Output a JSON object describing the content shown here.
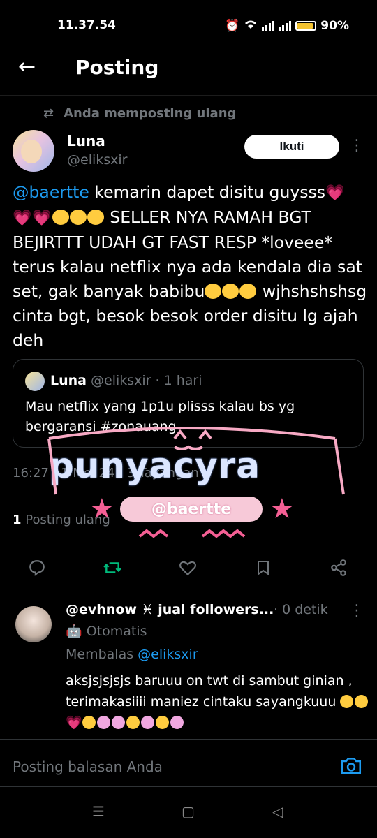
{
  "status_bar": {
    "time": "11.37.54",
    "battery": "90%",
    "battery_level": 0.9
  },
  "header": {
    "title": "Posting"
  },
  "repost_label": "Anda memposting ulang",
  "post": {
    "author_name": "Luna",
    "author_handle": "@eliksxir",
    "follow_label": "Ikuti",
    "mention": "@baertte",
    "text_line1": " kemarin dapet disitu guysss",
    "text_caps": "  SELLER NYA RAMAH BGT BEJIRTTT UDAH GT FAST RESP *loveee* terus kalau netflix nya ada kendala dia sat set, gak banyak babibu",
    "text_end": " wjhshshshsg cinta bgt, besok besok order disitu lg ajah deh",
    "timestamp": "16:27 · 1 Mei 24 · 3 Tayangan",
    "repost_count": "1",
    "repost_count_label": "Posting ulang"
  },
  "quote": {
    "author_name": "Luna",
    "meta": "@eliksxir · 1 hari",
    "text": "Mau netflix yang 1p1u plisss kalau bs yg bergaransi #zonauang"
  },
  "watermark": {
    "title": "punyacyra",
    "handle": "@baertte"
  },
  "actions": {
    "reply_icon": "comment-icon",
    "repost_icon": "repost-icon",
    "like_icon": "heart-icon",
    "bookmark_icon": "bookmark-icon",
    "share_icon": "share-icon"
  },
  "reply": {
    "author_name": "@evhnow ♓ jual followers...",
    "time": "· 0 detik",
    "automated_label": "Otomatis",
    "replying_prefix": "Membalas ",
    "replying_handle": "@eliksxir",
    "text": "aksjsjsjsjs baruuu on twt di sambut ginian , terimakasiiii maniez cintaku sayangkuuu"
  },
  "composer": {
    "placeholder": "Posting balasan Anda"
  },
  "colors": {
    "accent": "#1d9bf0",
    "repost_active": "#00ba7c",
    "background": "#000000",
    "muted": "#71767b"
  }
}
